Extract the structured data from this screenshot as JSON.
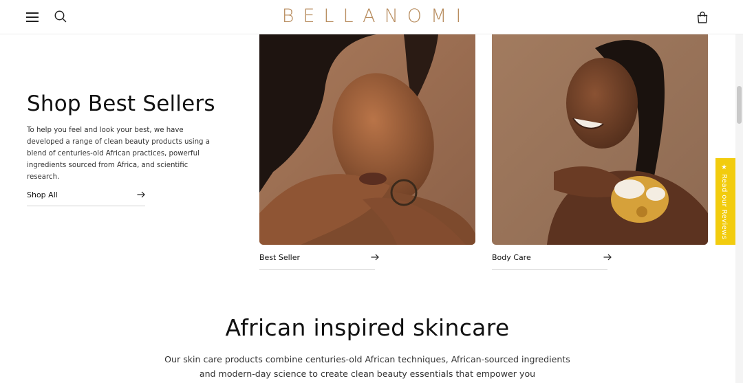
{
  "brand": {
    "logo_text": "BELLANOMI",
    "logo_color": "#b88d5f"
  },
  "header": {
    "menu_icon": "hamburger-menu-icon",
    "search_icon": "search-icon",
    "cart_icon": "shopping-bag-icon"
  },
  "hero": {
    "title": "Shop Best Sellers",
    "description": "To help you feel and look your best, we have developed a range of clean beauty products using a blend of centuries-old African practices, powerful ingredients sourced from Africa, and scientific research.",
    "cta_label": "Shop All",
    "cta_icon": "arrow-right-icon"
  },
  "collections": [
    {
      "label": "Best Seller",
      "image": "woman-eyes-closed-hands-on-shoulders-photo",
      "icon": "arrow-right-icon"
    },
    {
      "label": "Body Care",
      "image": "smiling-woman-with-bath-sponge-photo",
      "icon": "arrow-right-icon"
    }
  ],
  "reviews_tab": {
    "label": "★ Read our Reviews",
    "color": "#f2cc0e"
  },
  "section": {
    "title": "African inspired skincare",
    "body": "Our skin care products combine centuries-old African techniques, African-sourced ingredients and modern-day science to create clean beauty essentials that empower you"
  },
  "colors": {
    "accent": "#b88d5f",
    "background": "#ffffff",
    "text": "#111111",
    "photo_background": "#9c7354"
  }
}
